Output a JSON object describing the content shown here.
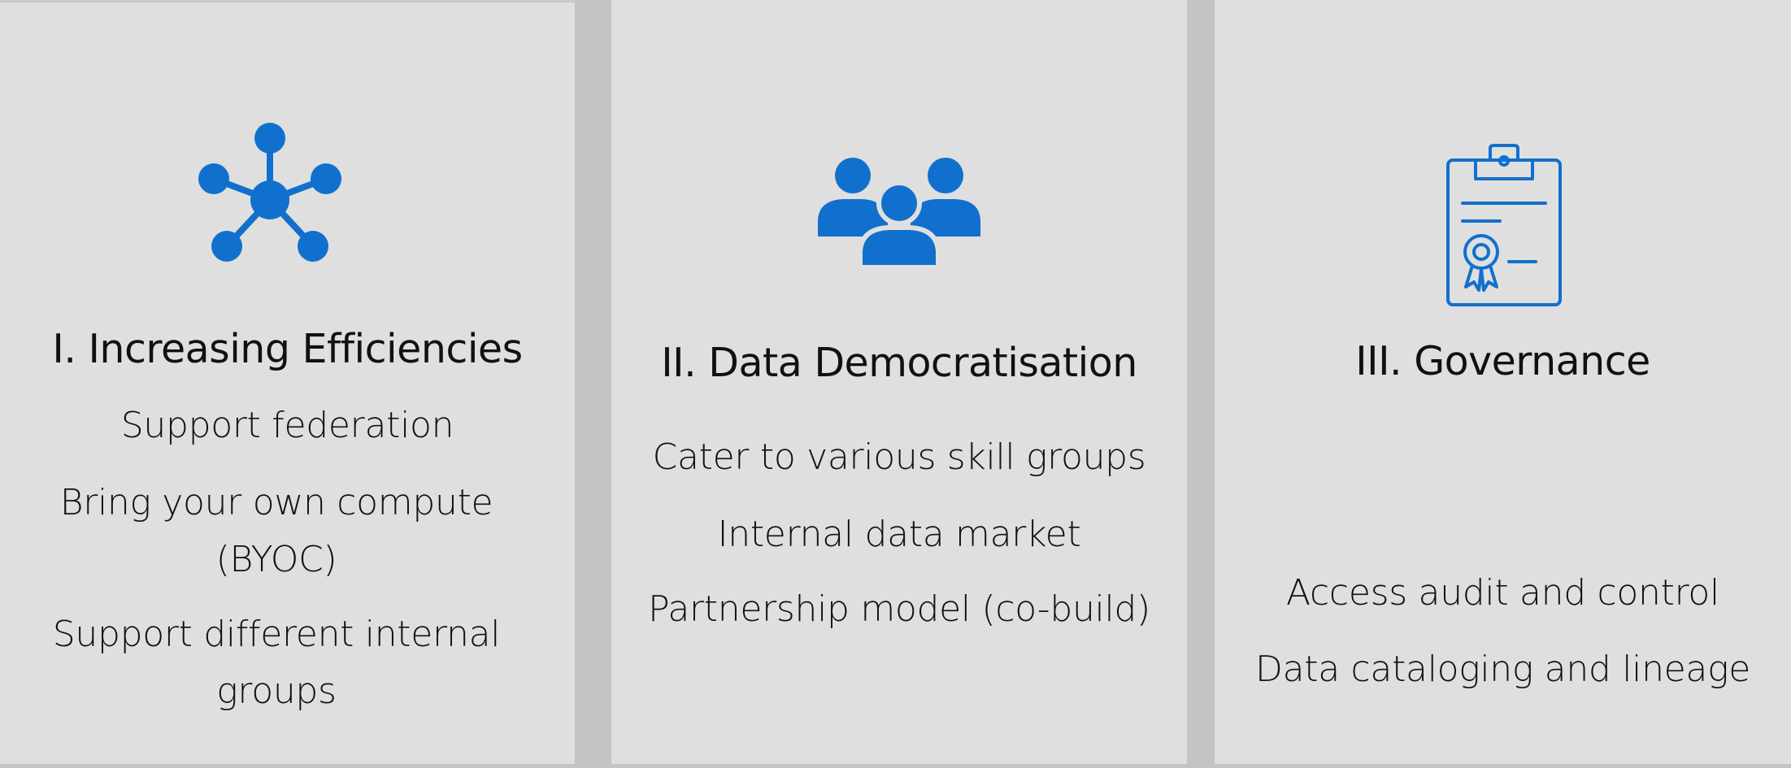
{
  "colors": {
    "background": "#c4c4c4",
    "panel": "#dfdfdf",
    "icon_blue": "#1170cd",
    "text": "#111111"
  },
  "panels": [
    {
      "icon": "network-hub-icon",
      "title": "I. Increasing Efficiencies",
      "items": [
        "Support federation",
        "Bring your own compute (BYOC)",
        "Support different internal groups"
      ]
    },
    {
      "icon": "people-group-icon",
      "title": "II. Data Democratisation",
      "items": [
        "Cater to various skill groups",
        "Internal data market",
        "Partnership model (co-build)"
      ]
    },
    {
      "icon": "clipboard-certificate-icon",
      "title": "III. Governance",
      "items": [
        "Access audit and control",
        "Data cataloging and lineage"
      ]
    }
  ]
}
